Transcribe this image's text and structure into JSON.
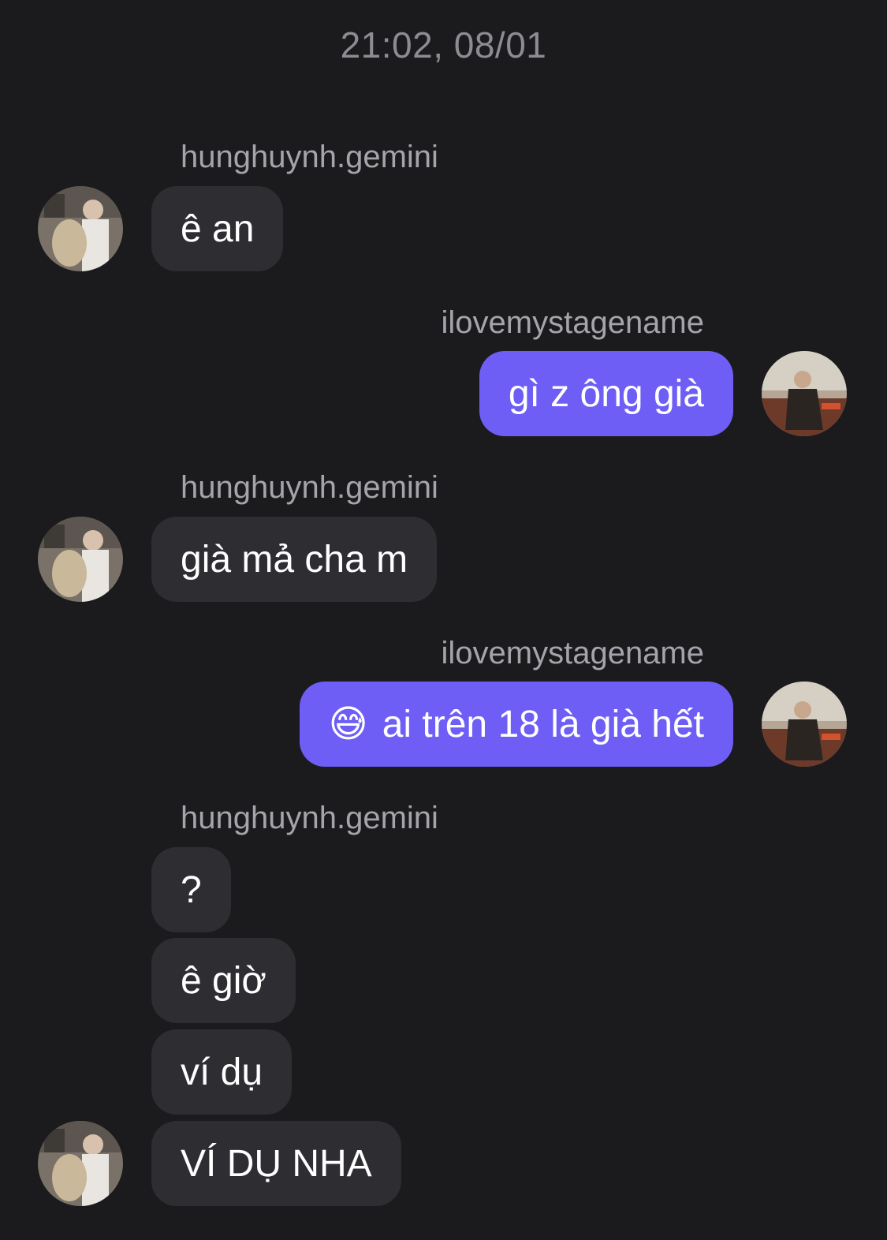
{
  "timestamp": "21:02, 08/01",
  "users": {
    "them": "hunghuynh.gemini",
    "me": "ilovemystagename"
  },
  "messages": [
    {
      "from": "them",
      "text": "ê an"
    },
    {
      "from": "me",
      "text": "gì z ông già"
    },
    {
      "from": "them",
      "text": "già mả cha m"
    },
    {
      "from": "me",
      "emoji": "😅",
      "text": "ai trên 18 là già hết"
    },
    {
      "from": "them",
      "text": "?"
    },
    {
      "from": "them",
      "text": "ê giờ"
    },
    {
      "from": "them",
      "text": "ví dụ"
    },
    {
      "from": "them",
      "text": "VÍ DỤ NHA"
    }
  ],
  "colors": {
    "background": "#1b1b1e",
    "incoming_bubble": "#2d2d32",
    "outgoing_bubble": "#6e5ef5",
    "secondary_text": "#a4a4aa"
  }
}
